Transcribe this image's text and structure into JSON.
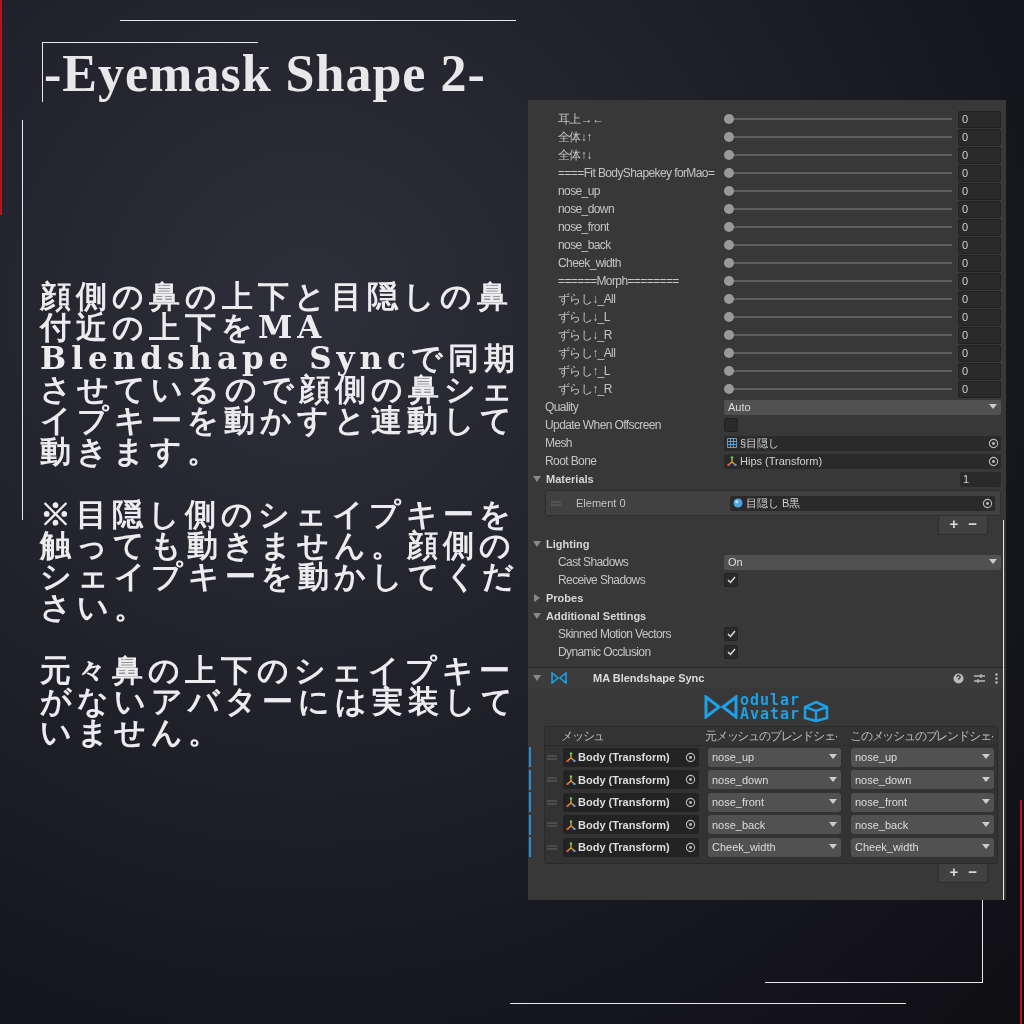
{
  "title": "-Eyemask Shape 2-",
  "paragraphs": [
    "顔側の鼻の上下と目隠しの鼻付近の上下をMA Blendshape Syncで同期させているので顔側の鼻シェイプキーを動かすと連動して動きます。",
    "※目隠し側のシェイプキーを触っても動きません。顔側のシェイプキーを動かしてください。",
    "元々鼻の上下のシェイプキーがないアバターには実装していません。"
  ],
  "inspector": {
    "blendshapes": [
      {
        "label": "耳上→←",
        "level": 0,
        "value": "0"
      },
      {
        "label": "全体↓↑",
        "level": 0,
        "value": "0"
      },
      {
        "label": "全体↑↓",
        "level": 0,
        "value": "0"
      },
      {
        "label": "====Fit BodyShapekey forMao=",
        "level": 0,
        "value": "0"
      },
      {
        "label": "nose_up",
        "level": 0,
        "value": "0"
      },
      {
        "label": "nose_down",
        "level": 0,
        "value": "0"
      },
      {
        "label": "nose_front",
        "level": 0,
        "value": "0"
      },
      {
        "label": "nose_back",
        "level": 0,
        "value": "0"
      },
      {
        "label": "Cheek_width",
        "level": 0,
        "value": "0"
      },
      {
        "label": "======Morph========",
        "level": 0,
        "value": "0"
      },
      {
        "label": "ずらし↓_All",
        "level": 0,
        "value": "0"
      },
      {
        "label": "ずらし↓_L",
        "level": 0,
        "value": "0"
      },
      {
        "label": "ずらし↓_R",
        "level": 0,
        "value": "0"
      },
      {
        "label": "ずらし↑_All",
        "level": 0,
        "value": "0"
      },
      {
        "label": "ずらし↑_L",
        "level": 0,
        "value": "0"
      },
      {
        "label": "ずらし↑_R",
        "level": 0,
        "value": "0"
      }
    ],
    "properties": [
      {
        "kind": "dropdown",
        "label": "Quality",
        "value": "Auto"
      },
      {
        "kind": "checkbox",
        "label": "Update When Offscreen",
        "checked": false
      },
      {
        "kind": "object",
        "label": "Mesh",
        "value": "§目隠し"
      },
      {
        "kind": "object",
        "label": "Root Bone",
        "value": "Hips (Transform)"
      }
    ],
    "materials": {
      "label": "Materials",
      "expanded": true,
      "count": "1",
      "elements": [
        {
          "label": "Element 0",
          "value": "目隠し B黒"
        }
      ],
      "add": "+",
      "remove": "−"
    },
    "sections": [
      {
        "label": "Lighting",
        "expanded": true,
        "fields": [
          {
            "kind": "dropdown",
            "label": "Cast Shadows",
            "value": "On"
          },
          {
            "kind": "checkbox",
            "label": "Receive Shadows",
            "checked": true
          }
        ]
      },
      {
        "label": "Probes",
        "expanded": false
      },
      {
        "label": "Additional Settings",
        "expanded": true,
        "fields": [
          {
            "kind": "checkbox",
            "label": "Skinned Motion Vectors",
            "checked": true
          },
          {
            "kind": "checkbox",
            "label": "Dynamic Occlusion",
            "checked": true
          }
        ]
      }
    ],
    "component": {
      "title": "MA Blendshape Sync",
      "expanded": true,
      "logo": [
        "odular",
        "Avatar"
      ],
      "columns": [
        "メッシュ",
        "元メッシュのブレンドシェ·",
        "このメッシュのブレンドシェ·"
      ],
      "rows": [
        {
          "mesh": "Body (Transform)",
          "source": "nose_up",
          "target": "nose_up"
        },
        {
          "mesh": "Body (Transform)",
          "source": "nose_down",
          "target": "nose_down"
        },
        {
          "mesh": "Body (Transform)",
          "source": "nose_front",
          "target": "nose_front"
        },
        {
          "mesh": "Body (Transform)",
          "source": "nose_back",
          "target": "nose_back"
        },
        {
          "mesh": "Body (Transform)",
          "source": "Cheek_width",
          "target": "Cheek_width"
        }
      ],
      "add": "+",
      "remove": "−"
    }
  }
}
